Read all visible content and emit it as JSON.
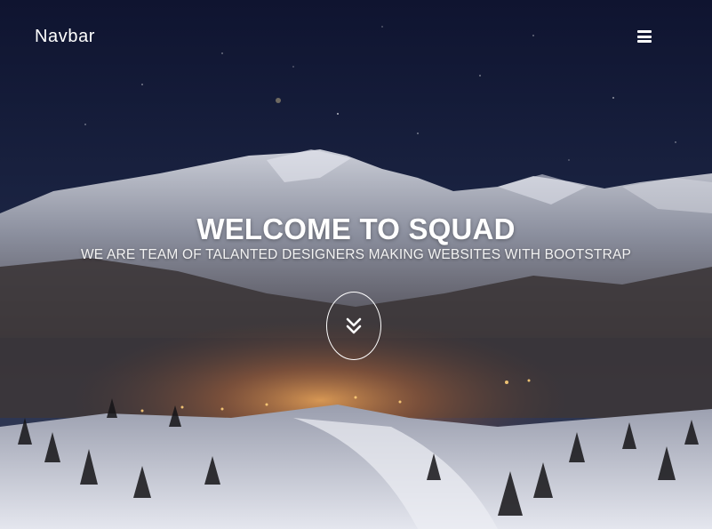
{
  "navbar": {
    "brand": "Navbar",
    "menu_icon": "bars-icon"
  },
  "hero": {
    "title": "WELCOME TO SQUAD",
    "subtitle": "WE ARE TEAM OF TALANTED DESIGNERS MAKING WEBSITES WITH BOOTSTRAP",
    "scroll_icon": "double-chevron-down-icon",
    "background": "night mountain ski resort photo"
  },
  "colors": {
    "text": "#ffffff",
    "sky_top": "#121833",
    "snow": "#d9dbe3",
    "glow": "#e8a45a"
  }
}
